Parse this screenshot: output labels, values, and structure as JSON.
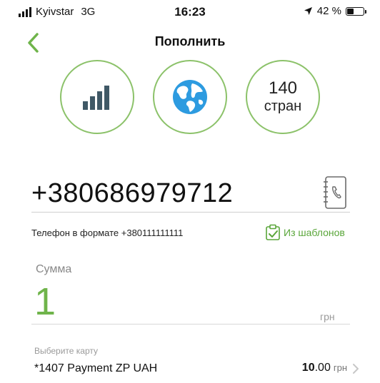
{
  "status_bar": {
    "carrier": "Kyivstar",
    "network": "3G",
    "time": "16:23",
    "battery_percent": "42 %"
  },
  "nav": {
    "title": "Пополнить"
  },
  "options": [
    {
      "icon": "signal-bars-icon"
    },
    {
      "icon": "globe-icon"
    },
    {
      "count": "140",
      "label": "стран"
    }
  ],
  "phone": {
    "value": "+380686979712",
    "hint": "Телефон в формате  +380111111111",
    "templates_label": "Из шаблонов"
  },
  "amount": {
    "label": "Сумма",
    "value": "1",
    "currency": "грн"
  },
  "card": {
    "label": "Выберите карту",
    "name": "*1407 Payment ZP UAH",
    "fee_whole": "10",
    "fee_decimal": ".00",
    "fee_unit": "грн"
  },
  "colors": {
    "accent": "#8cc26a",
    "amount": "#6fb44a",
    "globe": "#2d9be0",
    "signal": "#3f5866"
  }
}
